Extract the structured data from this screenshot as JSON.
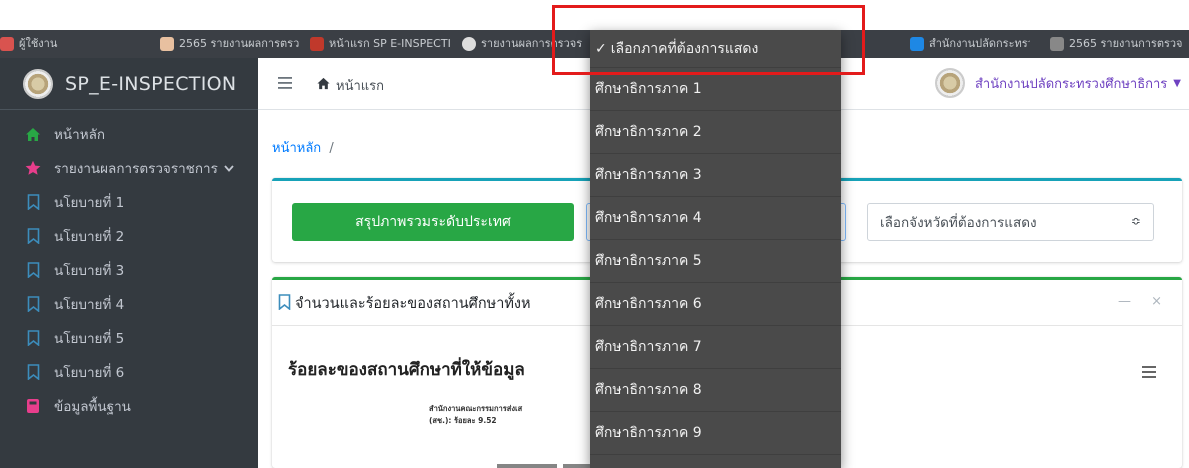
{
  "browser": {
    "tabs": [
      "ผู้ใช้งาน",
      "2565 รายงานผลการตรวจ",
      "หน้าแรก SP E-INSPECTION",
      "รายงานผลการตรวจราชการ",
      "สำนักงานปลัดกระทรวง",
      "2565 รายงานการตรวจ"
    ]
  },
  "sidebar": {
    "brand": "SP_E-INSPECTION",
    "items": [
      {
        "label": "หน้าหลัก",
        "icon": "home-icon"
      },
      {
        "label": "รายงานผลการตรวจราชการ",
        "icon": "star-icon"
      },
      {
        "label": "นโยบายที่ 1",
        "icon": "bookmark-icon"
      },
      {
        "label": "นโยบายที่ 2",
        "icon": "bookmark-icon"
      },
      {
        "label": "นโยบายที่ 3",
        "icon": "bookmark-icon"
      },
      {
        "label": "นโยบายที่ 4",
        "icon": "bookmark-icon"
      },
      {
        "label": "นโยบายที่ 5",
        "icon": "bookmark-icon"
      },
      {
        "label": "นโยบายที่ 6",
        "icon": "bookmark-icon"
      },
      {
        "label": "ข้อมูลพื้นฐาน",
        "icon": "database-icon"
      }
    ]
  },
  "navbar": {
    "home_label": "หน้าแรก",
    "org_name": "สำนักงานปลัดกระทรวงศึกษาธิการ"
  },
  "breadcrumb": {
    "home": "หน้าหลัก",
    "separator": "/"
  },
  "filters": {
    "summary_button": "สรุปภาพรวมระดับประเทศ",
    "province_placeholder": "เลือกจังหวัดที่ต้องการแสดง"
  },
  "card": {
    "title": "จำนวนและร้อยละของสถานศึกษาทั้งห",
    "chart_title": "ร้อยละของสถานศึกษาที่ให้ข้อมูล",
    "note_line1": "สำนักงานคณะกรรมการส่งเส",
    "note_line2": "(สช.): ร้อยละ 9.52"
  },
  "dropdown": {
    "selected": "เลือกภาคที่ต้องการแสดง",
    "options": [
      "ศึกษาธิการภาค 1",
      "ศึกษาธิการภาค 2",
      "ศึกษาธิการภาค 3",
      "ศึกษาธิการภาค 4",
      "ศึกษาธิการภาค 5",
      "ศึกษาธิการภาค 6",
      "ศึกษาธิการภาค 7",
      "ศึกษาธิการภาค 8",
      "ศึกษาธิการภาค 9"
    ]
  },
  "colors": {
    "sidebar_bg": "#343a40",
    "success": "#28a745",
    "info": "#17a2b8",
    "accent_purple": "#6f42c1",
    "highlight_red": "#e31b1b",
    "dropdown_bg": "#4a4a4a"
  }
}
